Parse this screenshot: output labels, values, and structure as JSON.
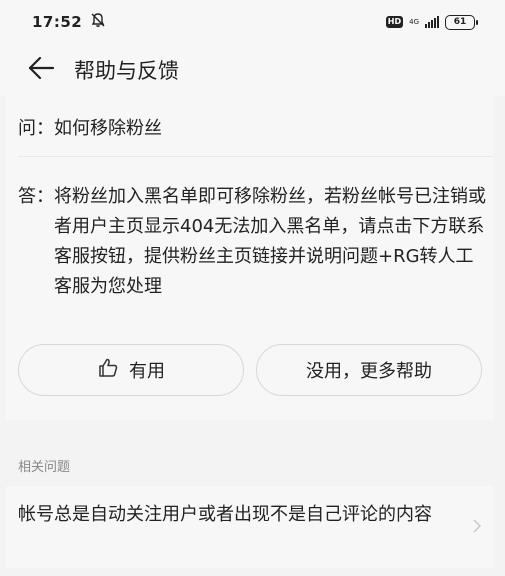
{
  "status_bar": {
    "time": "17:52",
    "hd": "HD",
    "network": "4G",
    "battery": "61",
    "icons": [
      "mute-bell-icon",
      "signal-icon",
      "battery-icon"
    ]
  },
  "header": {
    "title": "帮助与反馈",
    "back_icon": "back-arrow-icon"
  },
  "qa": {
    "question": "问：如何移除粉丝",
    "answer_prefix": "答：",
    "answer": "将粉丝加入黑名单即可移除粉丝，若粉丝帐号已注销或者用户主页显示404无法加入黑名单，请点击下方联系客服按钮，提供粉丝主页链接并说明问题+RG转人工客服为您处理"
  },
  "feedback": {
    "useful_label": "有用",
    "useful_icon": "thumbs-up-icon",
    "useless_label": "没用，更多帮助"
  },
  "related": {
    "section_label": "相关问题",
    "items": [
      {
        "text": "帐号总是自动关注用户或者出现不是自己评论的内容"
      }
    ]
  }
}
